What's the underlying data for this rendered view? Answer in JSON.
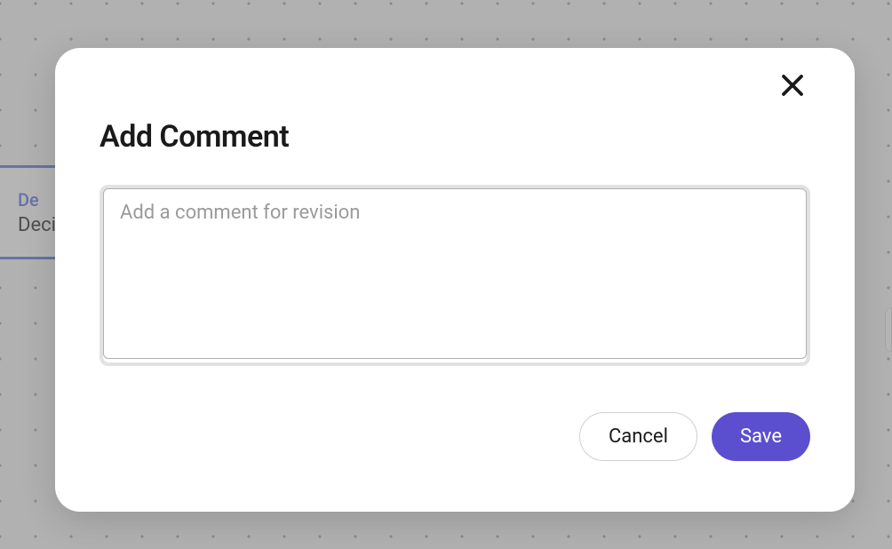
{
  "background": {
    "card_line1": "De",
    "card_line2": "Deci"
  },
  "modal": {
    "title": "Add Comment",
    "textarea": {
      "placeholder": "Add a comment for revision",
      "value": ""
    },
    "buttons": {
      "cancel_label": "Cancel",
      "save_label": "Save"
    }
  }
}
